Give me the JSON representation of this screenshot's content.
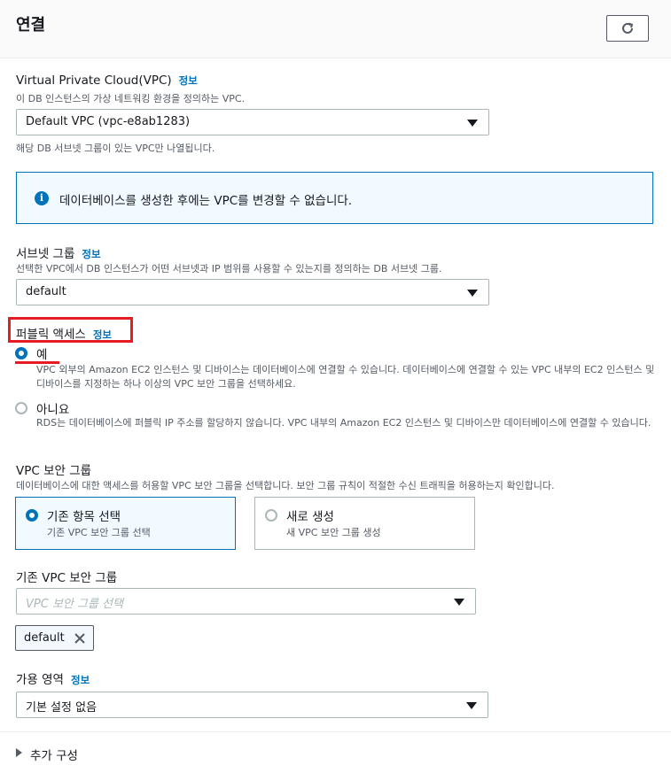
{
  "header": {
    "title": "연결",
    "refresh_icon": "refresh-icon"
  },
  "info_link": "정보",
  "vpc": {
    "label": "Virtual Private Cloud(VPC)",
    "description": "이 DB 인스턴스의 가상 네트워킹 환경을 정의하는 VPC.",
    "selected": "Default VPC (vpc-e8ab1283)",
    "help": "해당 DB 서브넷 그룹이 있는 VPC만 나열됩니다."
  },
  "alert": {
    "icon": "info-icon",
    "text": "데이터베이스를 생성한 후에는 VPC를 변경할 수 없습니다."
  },
  "subnet": {
    "label": "서브넷 그룹",
    "description": "선택한 VPC에서 DB 인스턴스가 어떤 서브넷과 IP 범위를 사용할 수 있는지를 정의하는 DB 서브넷 그룹.",
    "selected": "default"
  },
  "public_access": {
    "label": "퍼블릭 액세스",
    "options": [
      {
        "label": "예",
        "checked": true,
        "description": "VPC 외부의 Amazon EC2 인스턴스 및 디바이스는 데이터베이스에 연결할 수 있습니다. 데이터베이스에 연결할 수 있는 VPC 내부의 EC2 인스턴스 및 디바이스를 지정하는 하나 이상의 VPC 보안 그룹을 선택하세요."
      },
      {
        "label": "아니요",
        "checked": false,
        "description": "RDS는 데이터베이스에 퍼블릭 IP 주소를 할당하지 않습니다. VPC 내부의 Amazon EC2 인스턴스 및 디바이스만 데이터베이스에 연결할 수 있습니다."
      }
    ]
  },
  "security_group": {
    "label": "VPC 보안 그룹",
    "description": "데이터베이스에 대한 액세스를 허용할 VPC 보안 그룹을 선택합니다. 보안 그룹 규칙이 적절한 수신 트래픽을 허용하는지 확인합니다.",
    "tiles": [
      {
        "label": "기존 항목 선택",
        "description": "기존 VPC 보안 그룹 선택",
        "selected": true
      },
      {
        "label": "새로 생성",
        "description": "새 VPC 보안 그룹 생성",
        "selected": false
      }
    ]
  },
  "existing_sg": {
    "label": "기존 VPC 보안 그룹",
    "placeholder": "VPC 보안 그룹 선택",
    "token": "default"
  },
  "az": {
    "label": "가용 영역",
    "selected": "기본 설정 없음"
  },
  "additional": {
    "label": "추가 구성"
  },
  "colors": {
    "accent": "#0073bb",
    "highlight": "#e51c23",
    "alert_bg": "#f1faff"
  }
}
